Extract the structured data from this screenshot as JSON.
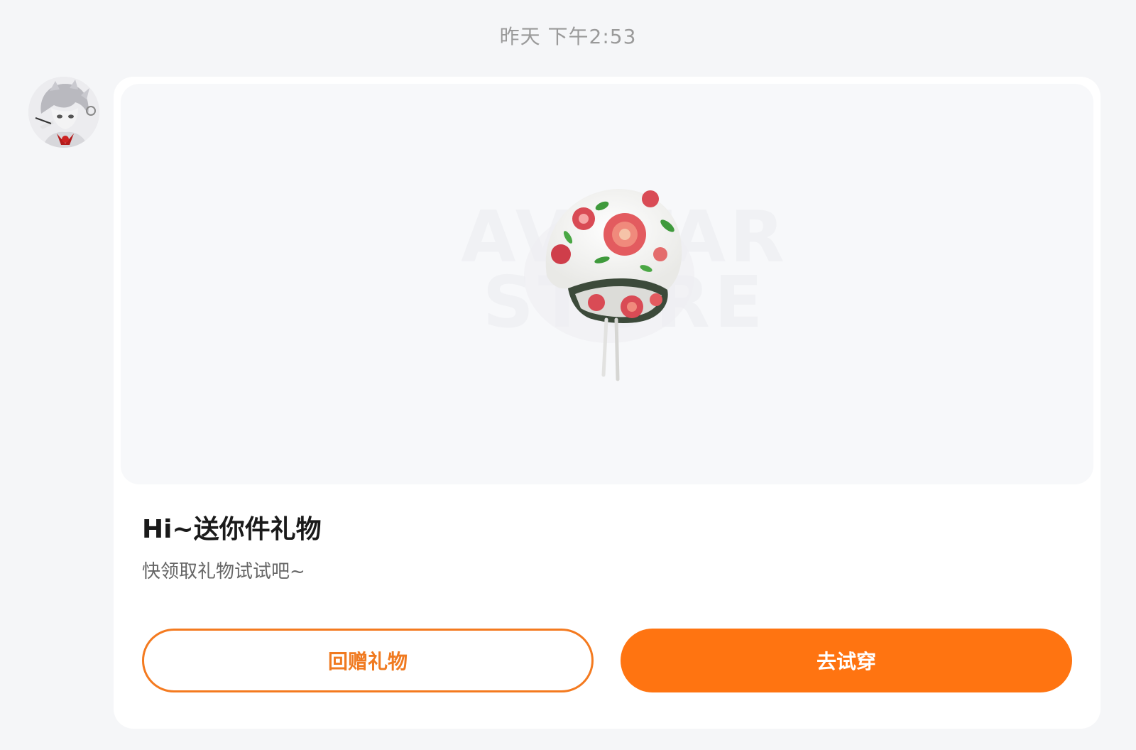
{
  "timestamp": "昨天 下午2:53",
  "sender": {
    "avatar_icon": "user-avatar-icon"
  },
  "gift_card": {
    "image_icon": "floral-bandana-hat-icon",
    "watermark": {
      "line1": "AVATAR",
      "line2": "STORE"
    },
    "title": "Hi~送你件礼物",
    "subtitle": "快领取礼物试试吧~",
    "buttons": {
      "return_gift_label": "回赠礼物",
      "try_on_label": "去试穿"
    },
    "colors": {
      "accent": "#ff7411",
      "outline": "#f47a1f",
      "card_background": "#ffffff",
      "page_background": "#f5f6f8"
    }
  }
}
